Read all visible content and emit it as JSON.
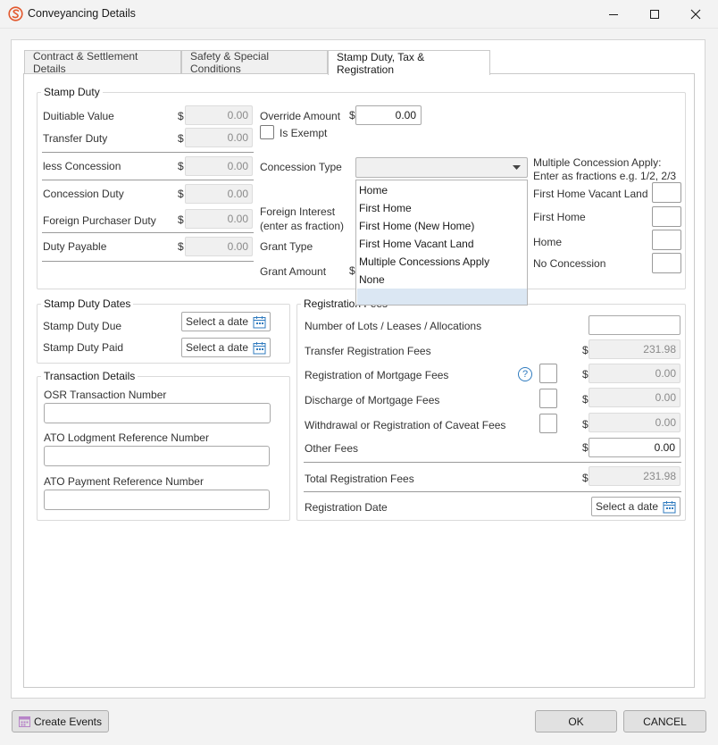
{
  "window": {
    "title": "Conveyancing Details",
    "controls": {
      "minimize": "minimize-icon",
      "maximize": "maximize-icon",
      "close": "close-icon"
    }
  },
  "tabs": [
    {
      "label": "Contract & Settlement Details",
      "active": false
    },
    {
      "label": "Safety & Special Conditions",
      "active": false
    },
    {
      "label": "Stamp Duty, Tax & Registration",
      "active": true
    }
  ],
  "currency_symbol": "$",
  "stamp_duty": {
    "title": "Stamp Duty",
    "rows": [
      {
        "label": "Duitiable Value",
        "value": "0.00"
      },
      {
        "label": "Transfer Duty",
        "value": "0.00"
      },
      {
        "label": "less Concession",
        "value": "0.00"
      },
      {
        "label": "Concession Duty",
        "value": "0.00"
      },
      {
        "label": "Foreign Purchaser Duty",
        "value": "0.00"
      },
      {
        "label": "Duty Payable",
        "value": "0.00"
      }
    ],
    "override_amount_label": "Override Amount",
    "override_amount_value": "0.00",
    "is_exempt_label": "Is Exempt",
    "concession_type_label": "Concession Type",
    "foreign_interest_label_1": "Foreign Interest",
    "foreign_interest_label_2": "(enter as fraction)",
    "grant_type_label": "Grant Type",
    "grant_amount_label": "Grant Amount",
    "multiple_concession_title_1": "Multiple Concession Apply:",
    "multiple_concession_title_2": "Enter as fractions e.g. 1/2, 2/3",
    "multiple_concessions": [
      {
        "label": "First Home Vacant Land",
        "value": ""
      },
      {
        "label": "First Home",
        "value": ""
      },
      {
        "label": "Home",
        "value": ""
      },
      {
        "label": "No Concession",
        "value": ""
      }
    ],
    "concession_dropdown": {
      "options": [
        "Home",
        "First Home",
        "First Home (New Home)",
        "First Home Vacant Land",
        "Multiple Concessions Apply",
        "None"
      ]
    }
  },
  "stamp_duty_dates": {
    "title": "Stamp Duty Dates",
    "due_label": "Stamp Duty Due",
    "paid_label": "Stamp Duty Paid",
    "date_placeholder": "Select a date"
  },
  "transaction_details": {
    "title": "Transaction Details",
    "osr_label": "OSR Transaction Number",
    "ato_lodgment_label": "ATO Lodgment Reference Number",
    "ato_payment_label": "ATO Payment Reference Number"
  },
  "registration_fees": {
    "title": "Registration Fees",
    "lots_label": "Number of Lots / Leases / Allocations",
    "transfer_label": "Transfer Registration Fees",
    "transfer_value": "231.98",
    "mortgage_label": "Registration of Mortgage Fees",
    "mortgage_value": "0.00",
    "help_glyph": "?",
    "discharge_label": "Discharge of Mortgage Fees",
    "discharge_value": "0.00",
    "caveat_label": "Withdrawal or Registration of Caveat Fees",
    "caveat_value": "0.00",
    "other_label": "Other Fees",
    "other_value": "0.00",
    "total_label": "Total Registration Fees",
    "total_value": "231.98",
    "date_label": "Registration Date",
    "date_placeholder": "Select a date"
  },
  "footer": {
    "create_events_label": "Create Events",
    "ok_label": "OK",
    "cancel_label": "CANCEL"
  },
  "colors": {
    "app_icon": "#e2572c",
    "dropdown_selected": "#dbe7f3",
    "calendar_icon": "#2f7bbf",
    "create_events_icon": "#b784c8"
  }
}
